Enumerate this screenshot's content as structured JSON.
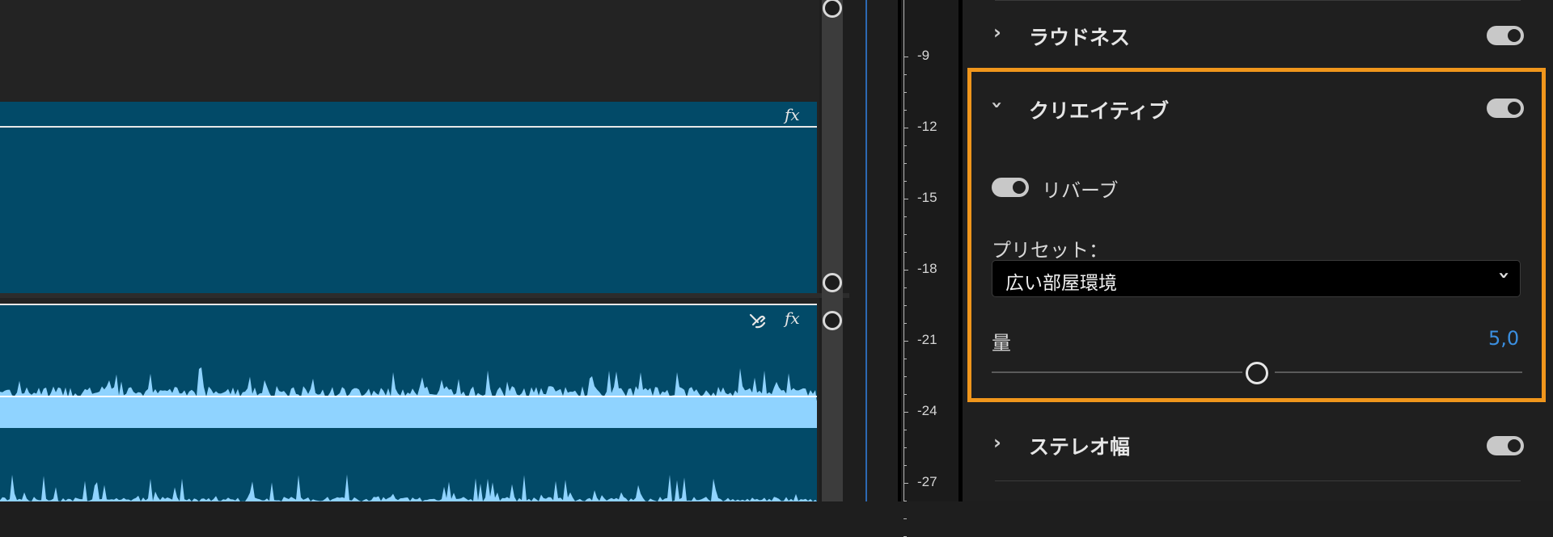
{
  "timeline": {
    "clip1_fx_label": "fx",
    "clip2_fx_label": "fx"
  },
  "meter": {
    "ticks": [
      "-9",
      "-12",
      "-15",
      "-18",
      "-21",
      "-24",
      "-27"
    ]
  },
  "panel": {
    "sections": {
      "loudness": {
        "title": "ラウドネス",
        "enabled": true
      },
      "creative": {
        "title": "クリエイティブ",
        "enabled": true,
        "expanded": true
      },
      "stereo_width": {
        "title": "ステレオ幅",
        "enabled": true
      }
    },
    "reverb": {
      "label": "リバーブ",
      "enabled": true
    },
    "preset": {
      "label": "プリセット：",
      "value": "広い部屋環境"
    },
    "amount": {
      "label": "量",
      "value": "5,0",
      "fraction": 0.5
    }
  },
  "colors": {
    "clip": "#024a68",
    "waveform": "#8fd3ff",
    "highlight": "#f0961c",
    "value_accent": "#3b8fe0"
  },
  "icons": {
    "section_collapsed": "chevron-right-icon",
    "section_expanded": "chevron-down-icon",
    "dropdown": "chevron-down-icon",
    "clip2_extra": "speech-enhance-icon"
  }
}
